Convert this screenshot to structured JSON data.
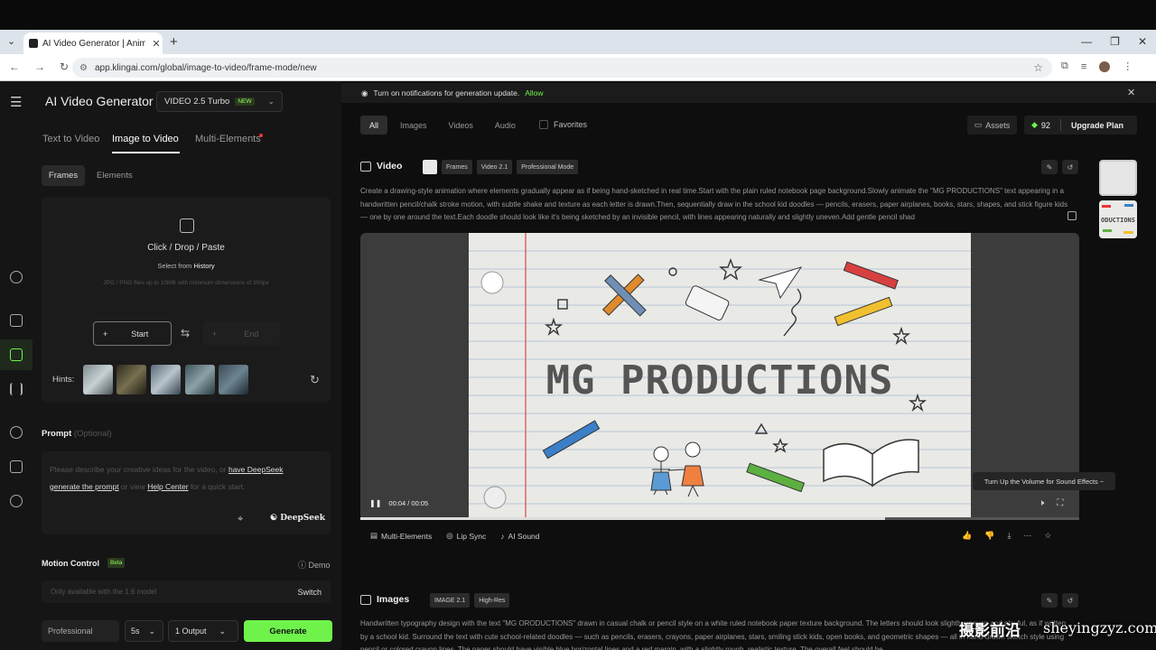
{
  "browser": {
    "tab_title": "AI Video Generator | Animate P",
    "url": "app.klingai.com/global/image-to-video/frame-mode/new"
  },
  "app": {
    "title": "AI Video Generator",
    "model": "VIDEO 2.5 Turbo",
    "model_badge": "NEW",
    "mode_tabs": [
      "Text to Video",
      "Image to Video",
      "Multi-Elements"
    ],
    "sub_tabs": [
      "Frames",
      "Elements"
    ],
    "upload": {
      "main": "Click / Drop / Paste",
      "select_prefix": "Select from",
      "select_link": "History",
      "hint": "JPG / PNG files up to 10MB with minimum dimensions of 300px"
    },
    "start_label": "Start",
    "end_label": "End",
    "hints_label": "Hints:",
    "prompt": {
      "label": "Prompt",
      "optional": "(Optional)",
      "p1": "Please describe your creative ideas for the video, or ",
      "l1": "have DeepSeek",
      "l1b": "generate the prompt",
      "p2": " or view ",
      "l2": "Help Center",
      "p3": " for a quick start.",
      "deepseek": "DeepSeek"
    },
    "motion": {
      "label": "Motion Control",
      "badge": "Beta",
      "demo": "Demo",
      "placeholder": "Only available with the 1.6 model",
      "switch": "Switch"
    },
    "quality": "Professional",
    "duration": "5s",
    "outputs": "1 Output",
    "generate": "Generate"
  },
  "notification": {
    "text": "Turn on notifications for generation update.",
    "allow": "Allow"
  },
  "filters": {
    "tabs": [
      "All",
      "Images",
      "Videos",
      "Audio"
    ],
    "active": "All",
    "favorites": "Favorites"
  },
  "account": {
    "assets": "Assets",
    "credits": "92",
    "upgrade": "Upgrade Plan"
  },
  "video_card": {
    "title": "Video",
    "tags": [
      "Frames",
      "Video 2.1",
      "Professional Mode"
    ],
    "description": "Create a drawing-style animation where elements gradually appear as if being hand-sketched in real time.Start with the plain ruled notebook page background.Slowly animate the \"MG PRODUCTIONS\" text appearing in a handwritten pencil/chalk stroke motion, with subtle shake and texture as each letter is drawn.Then, sequentially draw in the school kid doodles — pencils, erasers, paper airplanes, books, stars, shapes, and stick figure kids — one by one around the text.Each doodle should look like it's being sketched by an invisible pencil, with lines appearing naturally and slightly uneven.Add gentle pencil shad",
    "frame_text": "MG PRODUCTIONS",
    "time": "00:04 / 00:05",
    "progress": 0.73,
    "tooltip": "Turn Up the Volume for Sound Effects ~",
    "actions": [
      "Multi-Elements",
      "Lip Sync",
      "AI Sound"
    ]
  },
  "images_card": {
    "title": "Images",
    "tags": [
      "IMAGE 2.1",
      "High-Res"
    ],
    "description": "Handwritten typography design with the text \"MG ORODUCTIONS\" drawn in casual chalk or pencil style on a white ruled notebook paper texture background. The letters should look slightly uneven and playful, as if written by a school kid. Surround the text with cute school-related doodles — such as pencils, erasers, crayons, paper airplanes, stars, smiling stick kids, open books, and geometric shapes — all in hand-drawn sketch style using pencil or colored crayon lines. The paper should have visible blue horizontal lines and a red margin, with a slightly rough, realistic texture. The overall feel should be"
  },
  "thumb2_text": "ODUCTIONS",
  "watermark": {
    "cn": "摄影前沿",
    "site": "sheyingzyz.com"
  },
  "colors": {
    "accent": "#6ff34b",
    "bg": "#0e0e0e",
    "panel": "#151515"
  }
}
